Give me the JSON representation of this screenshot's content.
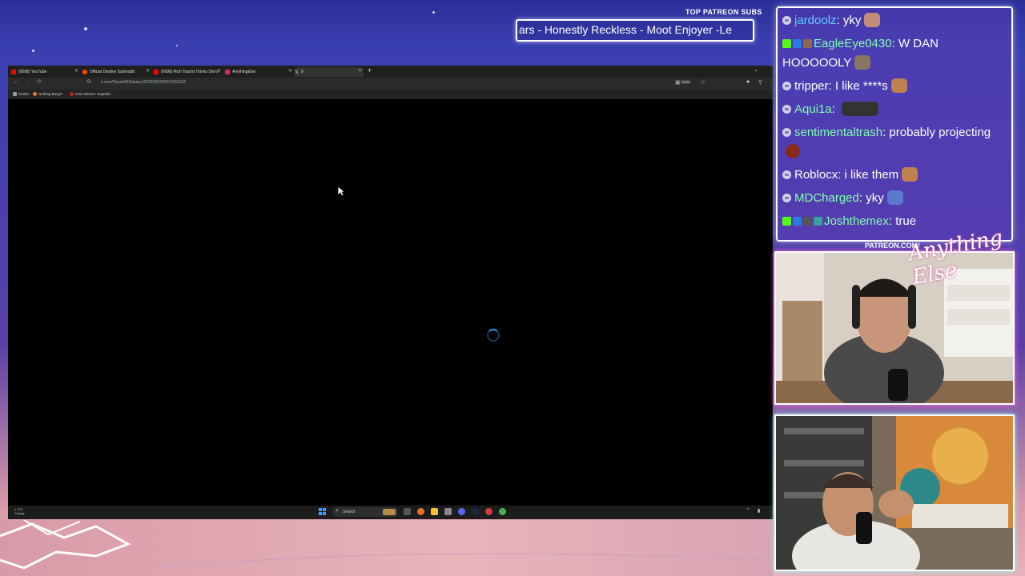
{
  "stream": {
    "patreon_label": "TOP PATREON SUBS",
    "patreon_marquee": "ars - Honestly Reckless - Moot Enjoyer -Le",
    "cam_label": "PATREON.COM/",
    "logo_text": "Anything Else"
  },
  "browser": {
    "tabs": [
      {
        "label": "(6098) YouTube",
        "color": "#ff0000"
      },
      {
        "label": "Official Destiny Subreddit",
        "color": "#ff4500"
      },
      {
        "label": "(6098) Rich Tourist Thinks She's",
        "color": "#ff0000"
      },
      {
        "label": "AnythingElse",
        "color": "#e0245e"
      },
      {
        "label": "X",
        "color": "#ffffff",
        "active": true
      }
    ],
    "new_tab_icon": "+",
    "url": "x.com/Ossim653/status/2036038326431050126",
    "zoom": "150%",
    "bookmarks": [
      {
        "label": "Dailies",
        "color": "#999999"
      },
      {
        "label": "Nothing Burger",
        "color": "#e07a2a"
      },
      {
        "label": "Clair Obscur: Expediti...",
        "color": "#c02030"
      }
    ],
    "accent": "#1d9bf0"
  },
  "taskbar": {
    "weather_temp": "9°C",
    "weather_desc": "Cloudy",
    "search_placeholder": "Search"
  },
  "chat": {
    "messages": [
      {
        "user": "jardoolz",
        "text": "yky",
        "color": "#5fd0ff",
        "emote": "#c58a7a"
      },
      {
        "user": "EagleEye0430",
        "text": "W DAN HOOOOOLY",
        "color": "#7fffb0",
        "emote": "#8a7560"
      },
      {
        "user": "tripper",
        "text": "I like ****s",
        "color": "#ffffff",
        "emote": "#c08050"
      },
      {
        "user": "Aqui1a",
        "text": "",
        "color": "#7fffb0",
        "emote": "#333333"
      },
      {
        "user": "sentimentaltrash",
        "text": "probably projecting",
        "color": "#7fffb0",
        "emote": "#8a2a1a"
      },
      {
        "user": "Roblocx",
        "text": "i like them",
        "color": "#ffffff",
        "emote": "#c08050"
      },
      {
        "user": "MDCharged",
        "text": "yky",
        "color": "#7fffb0",
        "emote": "#5a7ad0"
      },
      {
        "user": "Joshthemex",
        "text": "true",
        "color": "#7fffb0",
        "emote": ""
      }
    ]
  }
}
